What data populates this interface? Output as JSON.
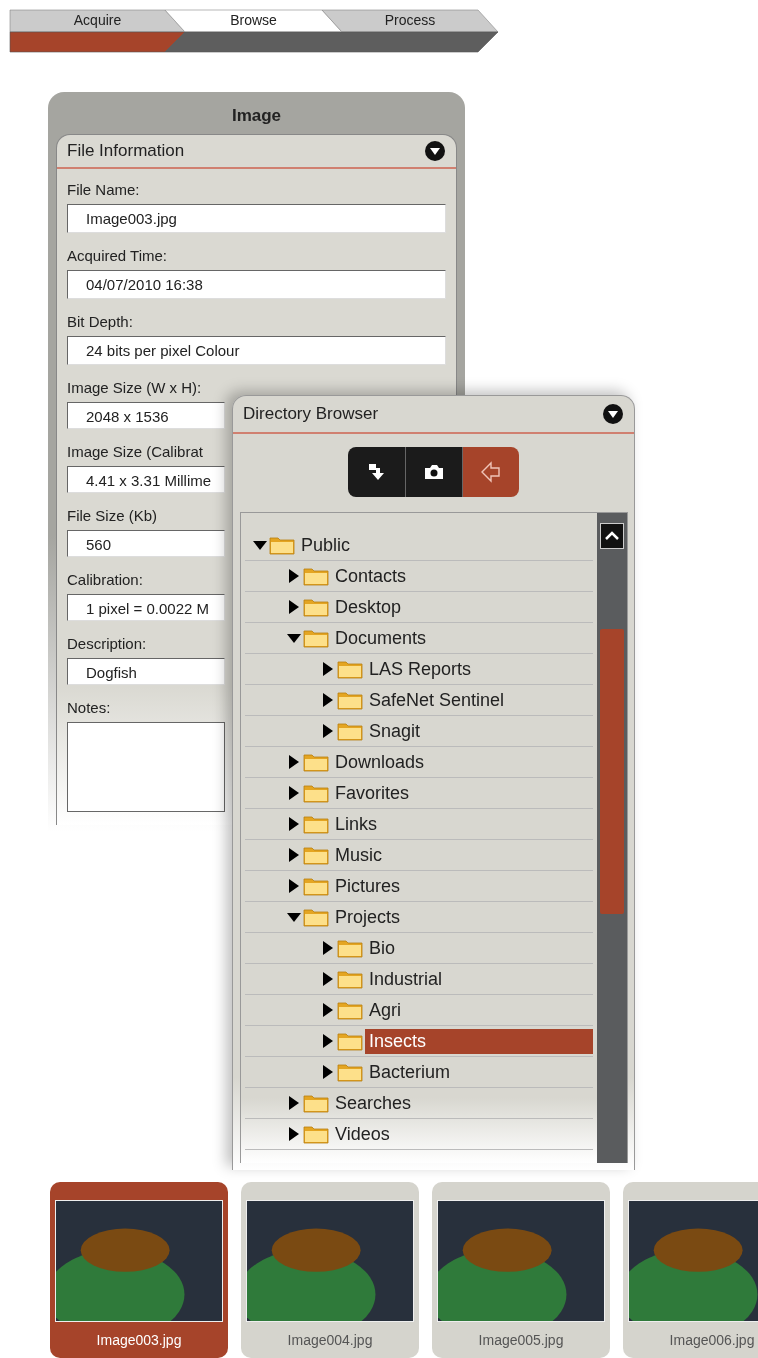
{
  "steps": [
    {
      "label": "Acquire",
      "selected": false,
      "done": true
    },
    {
      "label": "Browse",
      "selected": true,
      "done": false
    },
    {
      "label": "Process",
      "selected": false,
      "done": false
    }
  ],
  "image_panel": {
    "title": "Image",
    "section": {
      "title": "File Information",
      "expanded": true
    },
    "fields": [
      {
        "label": "File Name:",
        "value": "Image003.jpg"
      },
      {
        "label": "Acquired Time:",
        "value": "04/07/2010 16:38"
      },
      {
        "label": "Bit Depth:",
        "value": "24 bits per pixel Colour"
      },
      {
        "label": "Image Size (W x H):",
        "value": "2048 x 1536"
      },
      {
        "label": "Image Size (Calibrat",
        "value": "4.41 x 3.31 Millime"
      },
      {
        "label": "File Size (Kb)",
        "value": "560"
      },
      {
        "label": "Calibration:",
        "value": "1 pixel = 0.0022 M"
      },
      {
        "label": "Description:",
        "value": "Dogfish"
      }
    ],
    "notes": {
      "label": "Notes:"
    }
  },
  "directory": {
    "title": "Directory Browser",
    "expanded": true,
    "toolbar": [
      {
        "kind": "import",
        "selected": false
      },
      {
        "kind": "camera",
        "selected": false
      },
      {
        "kind": "back",
        "selected": true
      }
    ],
    "tree": [
      {
        "label": "Public",
        "expanded": true,
        "selected": false,
        "children": [
          {
            "label": "Contacts",
            "expanded": false,
            "selected": false
          },
          {
            "label": "Desktop",
            "expanded": false,
            "selected": false
          },
          {
            "label": "Documents",
            "expanded": true,
            "selected": false,
            "children": [
              {
                "label": "LAS Reports",
                "expanded": false,
                "selected": false
              },
              {
                "label": "SafeNet Sentinel",
                "expanded": false,
                "selected": false
              },
              {
                "label": "Snagit",
                "expanded": false,
                "selected": false
              }
            ]
          },
          {
            "label": "Downloads",
            "expanded": false,
            "selected": false
          },
          {
            "label": "Favorites",
            "expanded": false,
            "selected": false
          },
          {
            "label": "Links",
            "expanded": false,
            "selected": false
          },
          {
            "label": "Music",
            "expanded": false,
            "selected": false
          },
          {
            "label": "Pictures",
            "expanded": false,
            "selected": false
          },
          {
            "label": "Projects",
            "expanded": true,
            "selected": false,
            "children": [
              {
                "label": "Bio",
                "expanded": false,
                "selected": false
              },
              {
                "label": "Industrial",
                "expanded": false,
                "selected": false
              },
              {
                "label": "Agri",
                "expanded": false,
                "selected": false
              },
              {
                "label": "Insects",
                "expanded": false,
                "selected": true
              },
              {
                "label": "Bacterium",
                "expanded": false,
                "selected": false
              }
            ]
          },
          {
            "label": "Searches",
            "expanded": false,
            "selected": false
          },
          {
            "label": "Videos",
            "expanded": false,
            "selected": false
          }
        ]
      }
    ]
  },
  "thumbnails": [
    {
      "label": "Image003.jpg",
      "selected": true
    },
    {
      "label": "Image004.jpg",
      "selected": false
    },
    {
      "label": "Image005.jpg",
      "selected": false
    },
    {
      "label": "Image006.jpg",
      "selected": false
    }
  ]
}
